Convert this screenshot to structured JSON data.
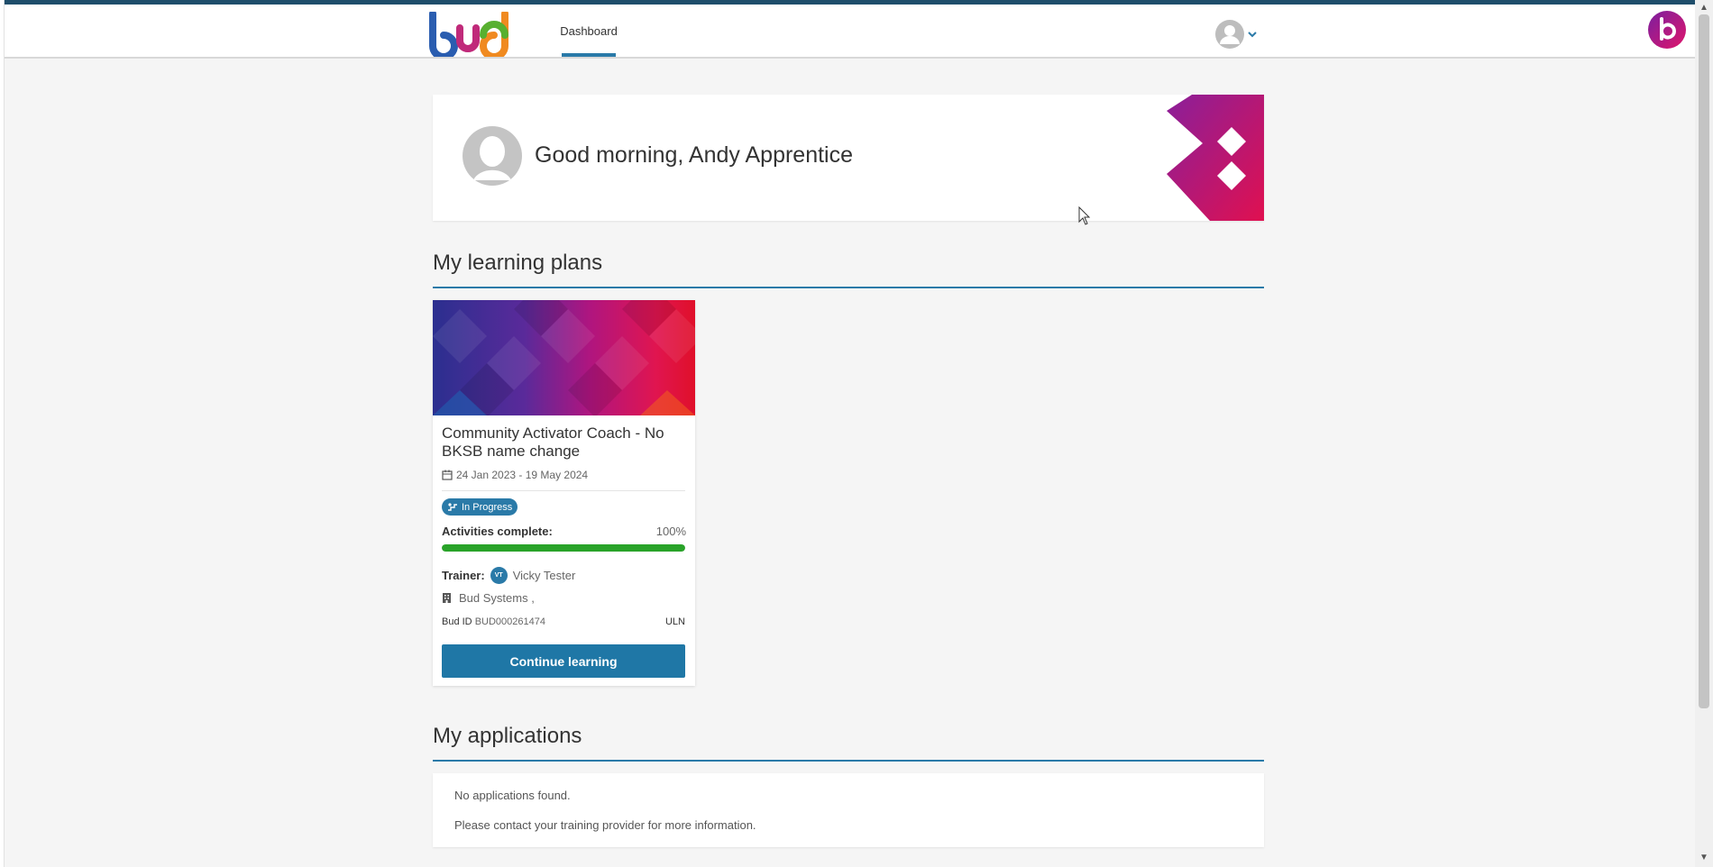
{
  "header": {
    "nav_tab": "Dashboard"
  },
  "greeting": {
    "text": "Good morning, Andy Apprentice"
  },
  "learning_plans": {
    "section_title": "My learning plans",
    "plans": [
      {
        "title": "Community Activator Coach - No BKSB name change",
        "dates": "24 Jan 2023 - 19 May 2024",
        "status": "In Progress",
        "activities_label": "Activities complete:",
        "activities_value": "100%",
        "progress_fraction": 1.0,
        "trainer_label": "Trainer:",
        "trainer_initials": "VT",
        "trainer_name": "Vicky Tester",
        "organisation": "Bud Systems ,",
        "bud_id_label": "Bud ID",
        "bud_id_value": "BUD000261474",
        "uln_label": "ULN",
        "button_label": "Continue learning"
      }
    ]
  },
  "applications": {
    "section_title": "My applications",
    "empty_line_1": "No applications found.",
    "empty_line_2": "Please contact your training provider for more information."
  },
  "colors": {
    "accent": "#2a7aa8",
    "progress": "#29a329",
    "header_stripe": "#1f4e6b"
  }
}
